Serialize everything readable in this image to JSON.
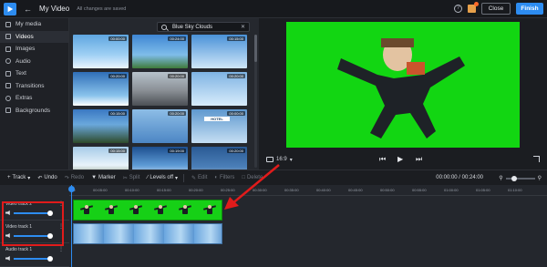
{
  "app": {
    "title": "My Video",
    "saved_status": "All changes are saved",
    "close_label": "Close",
    "finish_label": "Finish",
    "help_icon": "question-icon",
    "notification_icon": "gift-icon",
    "accent_color": "#2d8cf0"
  },
  "sidebar": {
    "items": [
      {
        "label": "My media",
        "icon": "folder-icon"
      },
      {
        "label": "Videos",
        "icon": "video-icon"
      },
      {
        "label": "Images",
        "icon": "image-icon"
      },
      {
        "label": "Audio",
        "icon": "music-icon"
      },
      {
        "label": "Text",
        "icon": "text-icon"
      },
      {
        "label": "Transitions",
        "icon": "transitions-icon"
      },
      {
        "label": "Extras",
        "icon": "extras-icon"
      },
      {
        "label": "Backgrounds",
        "icon": "backgrounds-icon"
      }
    ],
    "active_index": 1
  },
  "media": {
    "search_value": "Blue Sky Clouds",
    "durations": [
      "00:00:00",
      "00:24:00",
      "00:15:00",
      "00:20:00",
      "00:20:00",
      "00:20:00",
      "00:15:00",
      "00:20:00",
      "00:00:00",
      "00:15:00",
      "00:19:00",
      "00:20:00"
    ],
    "hotel_sign": "HOTEL"
  },
  "preview": {
    "aspect_ratio": "16:9",
    "background_color": "#12d612"
  },
  "toolbar": {
    "track_label": "Track",
    "undo_label": "Undo",
    "redo_label": "Redo",
    "marker_label": "Marker",
    "split_label": "Split",
    "levels_label": "Levels off",
    "edit_label": "Edit",
    "filters_label": "Filters",
    "delete_label": "Delete",
    "timecode": "00:00:00 / 00:24:00"
  },
  "timeline": {
    "ruler_ticks": [
      "00",
      "00:05:00",
      "00:10:00",
      "00:15:00",
      "00:20:00",
      "00:25:00",
      "00:30:00",
      "00:35:00",
      "00:40:00",
      "00:45:00",
      "00:50:00",
      "00:55:00",
      "01:00:00",
      "01:05:00",
      "01:10:00"
    ],
    "tracks": [
      {
        "label": "Video track 2"
      },
      {
        "label": "Video track 1"
      },
      {
        "label": "Audio track 1"
      }
    ]
  }
}
